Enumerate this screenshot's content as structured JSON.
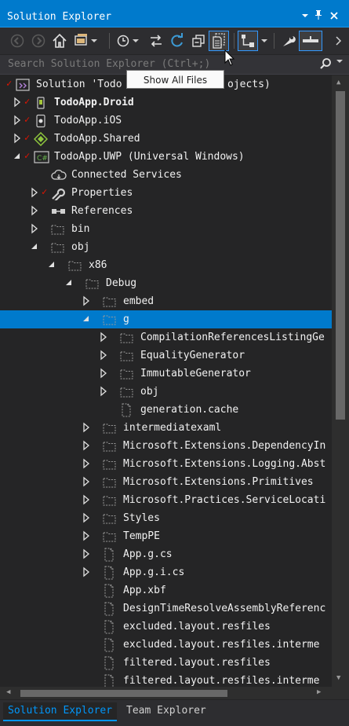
{
  "window": {
    "title": "Solution Explorer",
    "icons": [
      "dropdown-arrow-icon",
      "pin-icon",
      "close-icon"
    ]
  },
  "search": {
    "placeholder": "Search Solution Explorer (Ctrl+;)"
  },
  "tooltip": {
    "text": "Show All Files"
  },
  "tree": {
    "solution_label": "Solution 'Todo",
    "solution_label_tail": "ojects)",
    "rows": [
      {
        "label": "TodoApp.Droid",
        "icon": "android-project-icon",
        "bold": true,
        "checked": true,
        "expander": "collapsed"
      },
      {
        "label": "TodoApp.iOS",
        "icon": "ios-project-icon",
        "checked": true,
        "expander": "collapsed"
      },
      {
        "label": "TodoApp.Shared",
        "icon": "shared-project-icon",
        "checked": true,
        "expander": "collapsed"
      },
      {
        "label": "TodoApp.UWP (Universal Windows)",
        "icon": "csharp-project-icon",
        "checked": true,
        "expander": "expanded"
      },
      {
        "label": "Connected Services",
        "icon": "cloud-icon",
        "expander": "none"
      },
      {
        "label": "Properties",
        "icon": "wrench-icon",
        "checked": true,
        "expander": "collapsed"
      },
      {
        "label": "References",
        "icon": "references-icon",
        "expander": "collapsed"
      },
      {
        "label": "bin",
        "icon": "folder-icon",
        "expander": "collapsed"
      },
      {
        "label": "obj",
        "icon": "folder-icon",
        "expander": "expanded"
      },
      {
        "label": "x86",
        "icon": "folder-icon",
        "expander": "expanded"
      },
      {
        "label": "Debug",
        "icon": "folder-icon",
        "expander": "expanded"
      },
      {
        "label": "embed",
        "icon": "folder-icon",
        "expander": "collapsed"
      },
      {
        "label": "g",
        "icon": "folder-icon",
        "expander": "expanded",
        "selected": true
      },
      {
        "label": "CompilationReferencesListingGe",
        "icon": "folder-icon",
        "expander": "collapsed"
      },
      {
        "label": "EqualityGenerator",
        "icon": "folder-icon",
        "expander": "collapsed"
      },
      {
        "label": "ImmutableGenerator",
        "icon": "folder-icon",
        "expander": "collapsed"
      },
      {
        "label": "obj",
        "icon": "folder-icon",
        "expander": "collapsed"
      },
      {
        "label": "generation.cache",
        "icon": "file-icon",
        "expander": "none"
      },
      {
        "label": "intermediatexaml",
        "icon": "folder-icon",
        "expander": "collapsed"
      },
      {
        "label": "Microsoft.Extensions.DependencyIn",
        "icon": "folder-icon",
        "expander": "collapsed"
      },
      {
        "label": "Microsoft.Extensions.Logging.Abst",
        "icon": "folder-icon",
        "expander": "collapsed"
      },
      {
        "label": "Microsoft.Extensions.Primitives",
        "icon": "folder-icon",
        "expander": "collapsed"
      },
      {
        "label": "Microsoft.Practices.ServiceLocati",
        "icon": "folder-icon",
        "expander": "collapsed"
      },
      {
        "label": "Styles",
        "icon": "folder-icon",
        "expander": "collapsed"
      },
      {
        "label": "TempPE",
        "icon": "folder-icon",
        "expander": "collapsed"
      },
      {
        "label": "App.g.cs",
        "icon": "file-icon",
        "expander": "collapsed"
      },
      {
        "label": "App.g.i.cs",
        "icon": "file-icon",
        "expander": "collapsed"
      },
      {
        "label": "App.xbf",
        "icon": "file-icon",
        "expander": "none"
      },
      {
        "label": "DesignTimeResolveAssemblyReferenc",
        "icon": "file-icon",
        "expander": "none"
      },
      {
        "label": "excluded.layout.resfiles",
        "icon": "file-icon",
        "expander": "none"
      },
      {
        "label": "excluded.layout.resfiles.interme",
        "icon": "file-icon",
        "expander": "none"
      },
      {
        "label": "filtered.layout.resfiles",
        "icon": "file-icon",
        "expander": "none"
      },
      {
        "label": "filtered.layout.resfiles.interme",
        "icon": "file-icon",
        "expander": "none"
      }
    ]
  },
  "tabs": [
    {
      "label": "Solution Explorer",
      "active": true
    },
    {
      "label": "Team Explorer",
      "active": false
    }
  ],
  "colors": {
    "accent": "#007acc",
    "background": "#252526",
    "check": "#e51400",
    "active_tab_text": "#0097fb"
  }
}
